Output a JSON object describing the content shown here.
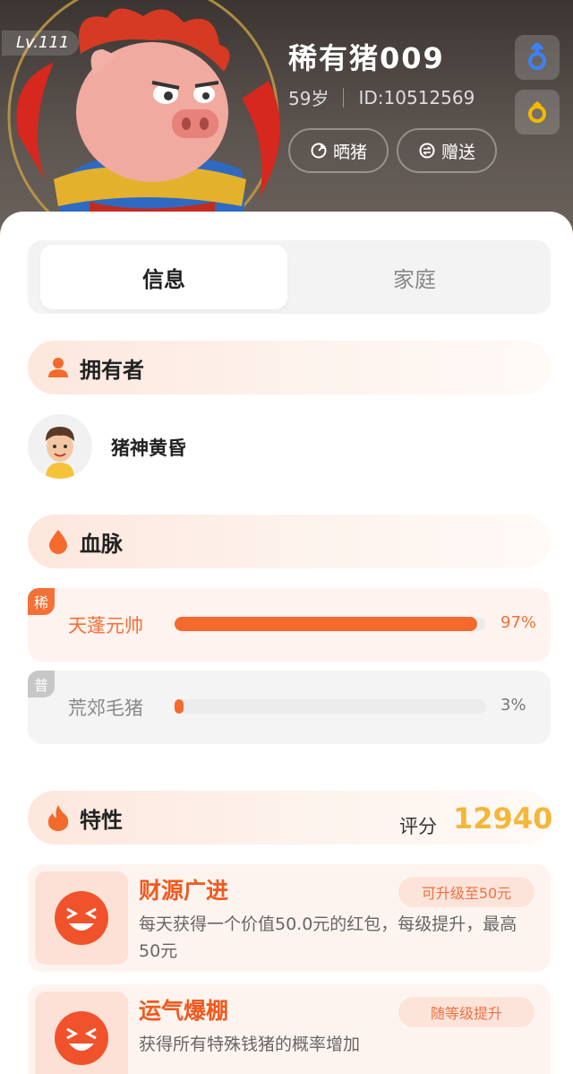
{
  "header": {
    "level": "Lv.111",
    "pig_name": "稀有猪009",
    "age": "59岁",
    "pig_id": "ID:10512569",
    "show_button": "晒猪",
    "gift_button": "赠送",
    "gender_icon": "male-symbol-icon",
    "ring_icon": "ring-icon"
  },
  "tabs": [
    {
      "label": "信息",
      "active": true
    },
    {
      "label": "家庭",
      "active": false
    }
  ],
  "owner_section": {
    "title": "拥有者",
    "owner_name": "猪神黄昏"
  },
  "bloodline_section": {
    "title": "血脉",
    "items": [
      {
        "tag": "稀",
        "name": "天蓬元帅",
        "percent_label": "97%",
        "percent": 97
      },
      {
        "tag": "普",
        "name": "荒郊毛猪",
        "percent_label": "3%",
        "percent": 3
      }
    ]
  },
  "traits_section": {
    "title": "特性",
    "score_label": "评分",
    "score": "12940",
    "items": [
      {
        "name": "财源广进",
        "badge": "可升级至50元",
        "desc": "每天获得一个价值50.0元的红包，每级提升，最高50元"
      },
      {
        "name": "运气爆棚",
        "badge": "随等级提升",
        "desc": "获得所有特殊钱猪的概率增加"
      }
    ]
  },
  "colors": {
    "accent": "#f46a2c",
    "score": "#f6b63a",
    "gender": "#3b82f6",
    "ring": "#f5b800"
  }
}
